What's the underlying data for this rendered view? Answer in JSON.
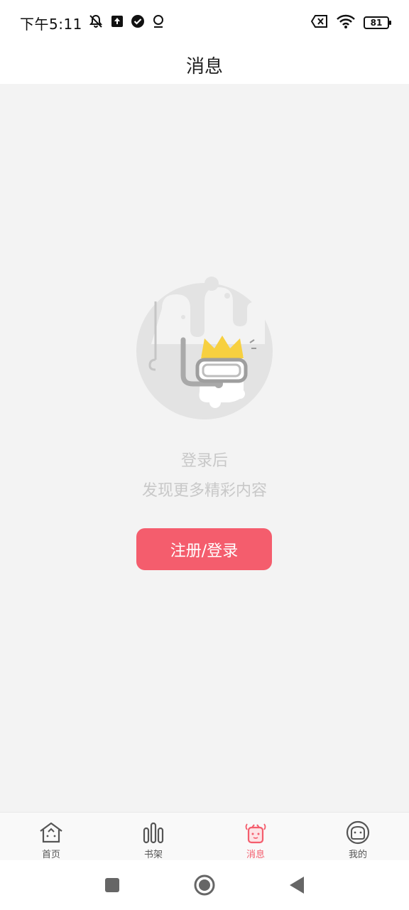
{
  "status_bar": {
    "time": "下午5:11",
    "battery_level": "81",
    "left_icons": [
      "mute-icon",
      "upload-icon",
      "check-circle-icon",
      "location-icon"
    ],
    "right_icons": [
      "no-sim-icon",
      "wifi-icon",
      "battery-icon"
    ]
  },
  "header": {
    "title": "消息"
  },
  "main": {
    "message_line1": "登录后",
    "message_line2": "发现更多精彩内容",
    "login_button_label": "注册/登录",
    "illustration": "diver-crown-illustration"
  },
  "tabs": [
    {
      "label": "首页",
      "icon": "home-icon",
      "active": false
    },
    {
      "label": "书架",
      "icon": "bookshelf-icon",
      "active": false
    },
    {
      "label": "消息",
      "icon": "message-icon",
      "active": true
    },
    {
      "label": "我的",
      "icon": "profile-icon",
      "active": false
    }
  ],
  "colors": {
    "accent": "#f45d6d",
    "background": "#f3f3f3",
    "muted_text": "#c8c8c8",
    "crown": "#f7d040"
  },
  "system_nav": [
    "recent-apps-icon",
    "home-circle-icon",
    "back-icon"
  ]
}
